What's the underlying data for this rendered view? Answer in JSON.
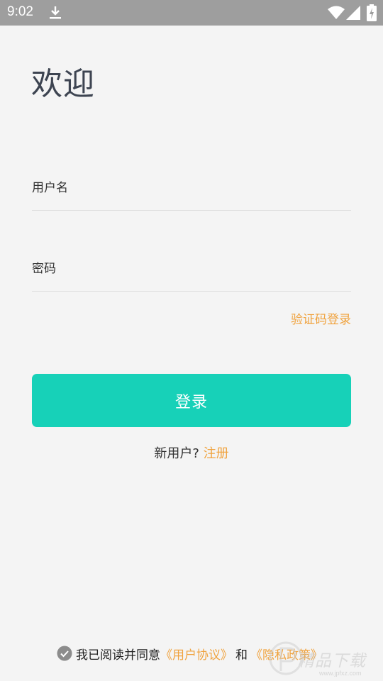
{
  "status_bar": {
    "time": "9:02",
    "icons": [
      "download-icon",
      "wifi-icon",
      "signal-icon",
      "battery-charging-icon"
    ]
  },
  "welcome_title": "欢迎",
  "username_field": {
    "placeholder": "用户名",
    "value": ""
  },
  "password_field": {
    "placeholder": "密码",
    "value": ""
  },
  "sms_login_label": "验证码登录",
  "login_button_label": "登录",
  "register": {
    "prompt": "新用户?",
    "link_label": "注册"
  },
  "agreement": {
    "text": "我已阅读并同意",
    "user_agreement_label": "《用户协议》",
    "and_text": "和",
    "privacy_policy_label": "《隐私政策》"
  },
  "watermark": {
    "text": "精品下载",
    "sub": "www.jpfxz.com"
  },
  "colors": {
    "accent": "#17d1b8",
    "link": "#f0a33f",
    "background": "#f4f4f4",
    "status_bar": "#9e9e9e"
  }
}
